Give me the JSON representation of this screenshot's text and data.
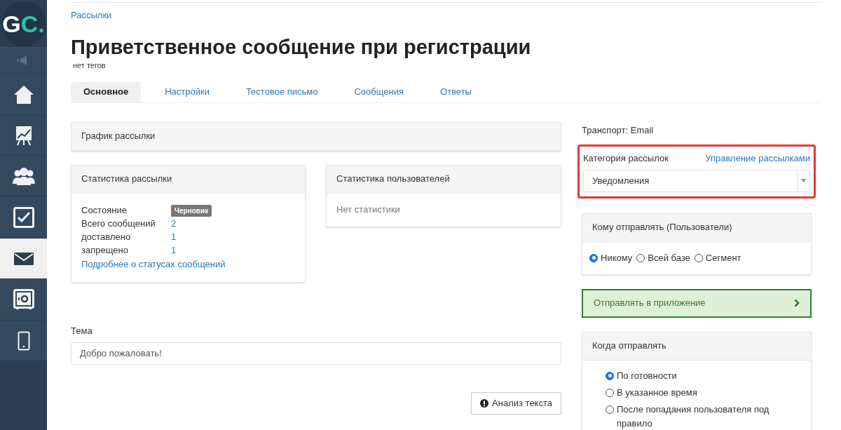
{
  "sidebar": {
    "logo": {
      "main": "G",
      "accent": "C."
    },
    "items": [
      {
        "kind": "sound",
        "selected": false
      },
      {
        "kind": "home",
        "selected": false
      },
      {
        "kind": "chart",
        "selected": false
      },
      {
        "kind": "users",
        "selected": false
      },
      {
        "kind": "tasks",
        "selected": false
      },
      {
        "kind": "mail",
        "selected": true
      },
      {
        "kind": "safe",
        "selected": false
      },
      {
        "kind": "phone",
        "selected": false
      }
    ]
  },
  "breadcrumb": "Рассылки",
  "title": "Приветственное сообщение при регистрации",
  "tags": "нет тегов",
  "tabs": [
    {
      "label": "Основное",
      "selected": true
    },
    {
      "label": "Настройки",
      "selected": false
    },
    {
      "label": "Тестовое письмо",
      "selected": false
    },
    {
      "label": "Сообщения",
      "selected": false
    },
    {
      "label": "Ответы",
      "selected": false
    }
  ],
  "schedule_panel": {
    "title": "График рассылки"
  },
  "mailing_stats": {
    "title": "Статистика рассылки",
    "rows": [
      {
        "label": "Состояние",
        "value": "Черновик",
        "kind": "badge"
      },
      {
        "label": "Всего сообщений",
        "value": "2",
        "kind": "link"
      },
      {
        "label": "доставлено",
        "value": "1",
        "kind": "link"
      },
      {
        "label": "запрещено",
        "value": "1",
        "kind": "link"
      }
    ],
    "more_link": "Подробнее о статусах сообщений"
  },
  "user_stats": {
    "title": "Статистика пользователей",
    "empty": "Нет статистики"
  },
  "subject": {
    "label": "Тема",
    "value": "Добро пожаловать!"
  },
  "analyze_button": "Анализ текста",
  "transport": "Транспорт: Email",
  "category": {
    "label": "Категория рассылок",
    "manage_link": "Управление рассылками",
    "value": "Уведомления",
    "highlighted": true
  },
  "recipients": {
    "title": "Кому отправлять (Пользователи)",
    "options": [
      {
        "label": "Никому",
        "selected": true
      },
      {
        "label": "Всей базе",
        "selected": false
      },
      {
        "label": "Сегмент",
        "selected": false
      }
    ]
  },
  "app_send": "Отправлять в приложение",
  "timing": {
    "title": "Когда отправлять",
    "options": [
      {
        "label": "По готовности",
        "selected": true
      },
      {
        "label": "В указанное время",
        "selected": false
      },
      {
        "label": "После попадания пользователя под правило",
        "selected": false
      }
    ]
  }
}
